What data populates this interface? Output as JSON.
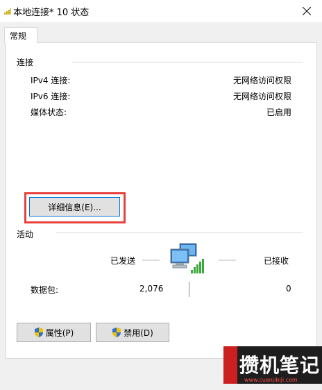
{
  "window": {
    "title": "本地连接* 10 状态"
  },
  "tabs": [
    {
      "label": "常规"
    }
  ],
  "connection": {
    "heading": "连接",
    "rows": [
      {
        "label": "IPv4 连接:",
        "value": "无网络访问权限"
      },
      {
        "label": "IPv6 连接:",
        "value": "无网络访问权限"
      },
      {
        "label": "媒体状态:",
        "value": "已启用"
      }
    ],
    "details_button": "详细信息(E)..."
  },
  "activity": {
    "heading": "活动",
    "sent_label": "已发送",
    "received_label": "已接收",
    "packets_label": "数据包:",
    "packets_sent": "2,076",
    "packets_received": "0"
  },
  "buttons": {
    "properties": "属性(P)",
    "disable": "禁用(D)"
  },
  "watermark": {
    "text": "攒机笔记",
    "url": "www.cuanjibiji.com"
  }
}
